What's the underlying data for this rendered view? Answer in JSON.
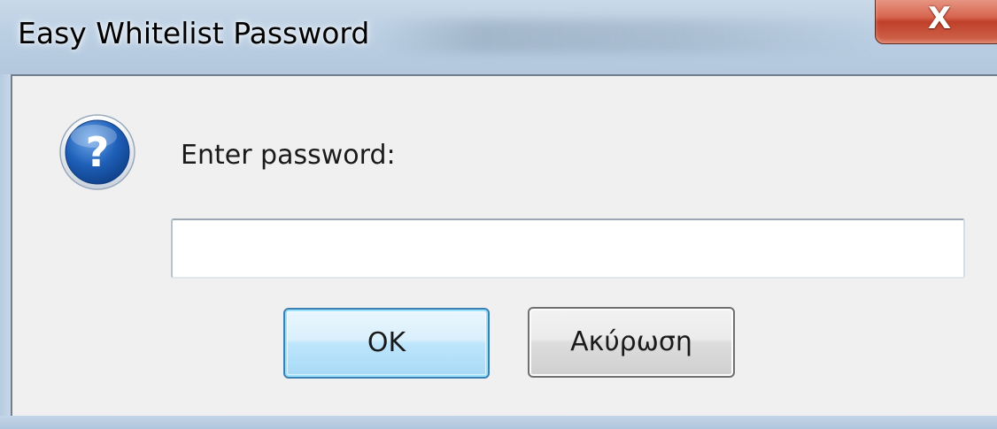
{
  "window": {
    "title": "Easy Whitelist Password",
    "close_glyph": "X"
  },
  "dialog": {
    "icon": "question-icon",
    "prompt": "Enter password:",
    "password_value": "",
    "ok_label": "OK",
    "cancel_label": "Ακύρωση"
  },
  "colors": {
    "accent": "#3c7fb1",
    "close_button": "#c0402a",
    "icon_blue": "#1b5fb8",
    "background": "#f0f0f0"
  }
}
